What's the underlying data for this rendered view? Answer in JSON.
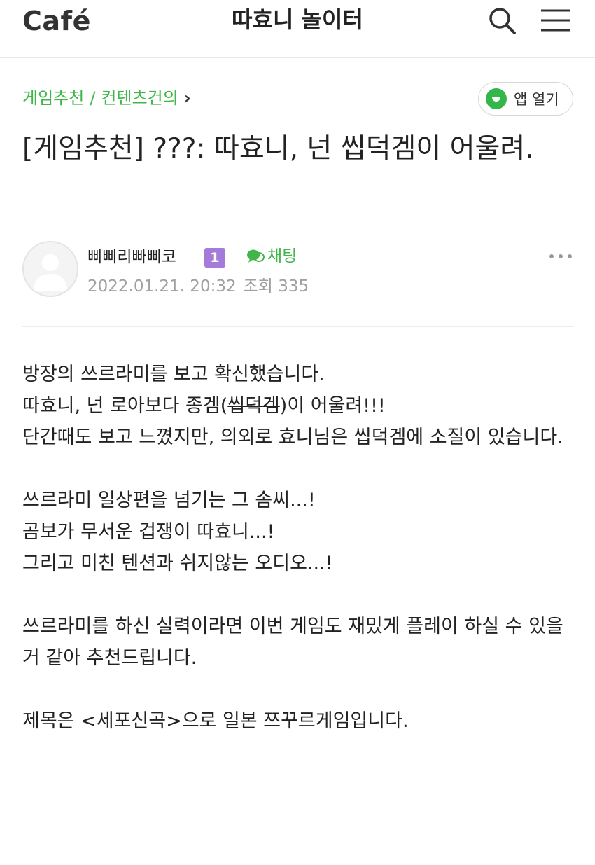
{
  "header": {
    "logo_text": "Café",
    "cafe_name": "따효니 놀이터",
    "search_icon": "search-icon",
    "menu_icon": "hamburger-menu-icon"
  },
  "breadcrumb": {
    "board": "게임추천",
    "separator": "/",
    "category": "컨텐츠건의",
    "chevron": "›"
  },
  "app_button": {
    "label": "앱 열기",
    "icon": "naver-cafe-leaf-icon",
    "accent": "#33b64a"
  },
  "post": {
    "title": "[게임추천] ???: 따효니, 넌 씹덕겜이 어울려.",
    "author": "삐삐리빠삐코",
    "level_badge": "1",
    "chat_label": "채팅",
    "date": "2022.01.21. 20:32",
    "views_label": "조회 335"
  },
  "body": {
    "line1": "방장의 쓰르라미를 보고 확신했습니다.",
    "line2_before": "따효니, 넌 로아보다 종겜(",
    "line2_strike": "씹덕겜",
    "line2_after": ")이 어울려!!!",
    "line3": "단간때도 보고 느꼈지만, 의외로 효니님은 씹덕겜에 소질이 있습니다.",
    "line4": "쓰르라미 일상편을 넘기는 그 솜씨...!",
    "line5": "곰보가 무서운 겁쟁이 따효니...!",
    "line6": "그리고 미친 텐션과 쉬지않는 오디오...!",
    "line7": "쓰르라미를 하신 실력이라면 이번 게임도 재밌게 플레이 하실 수 있을거 같아 추천드립니다.",
    "line8": "제목은 <세포신곡>으로 일본 쯔꾸르게임입니다."
  },
  "colors": {
    "brand_green": "#41b54a",
    "badge_purple": "#a57bd9",
    "meta_gray": "#a0a0a0"
  }
}
